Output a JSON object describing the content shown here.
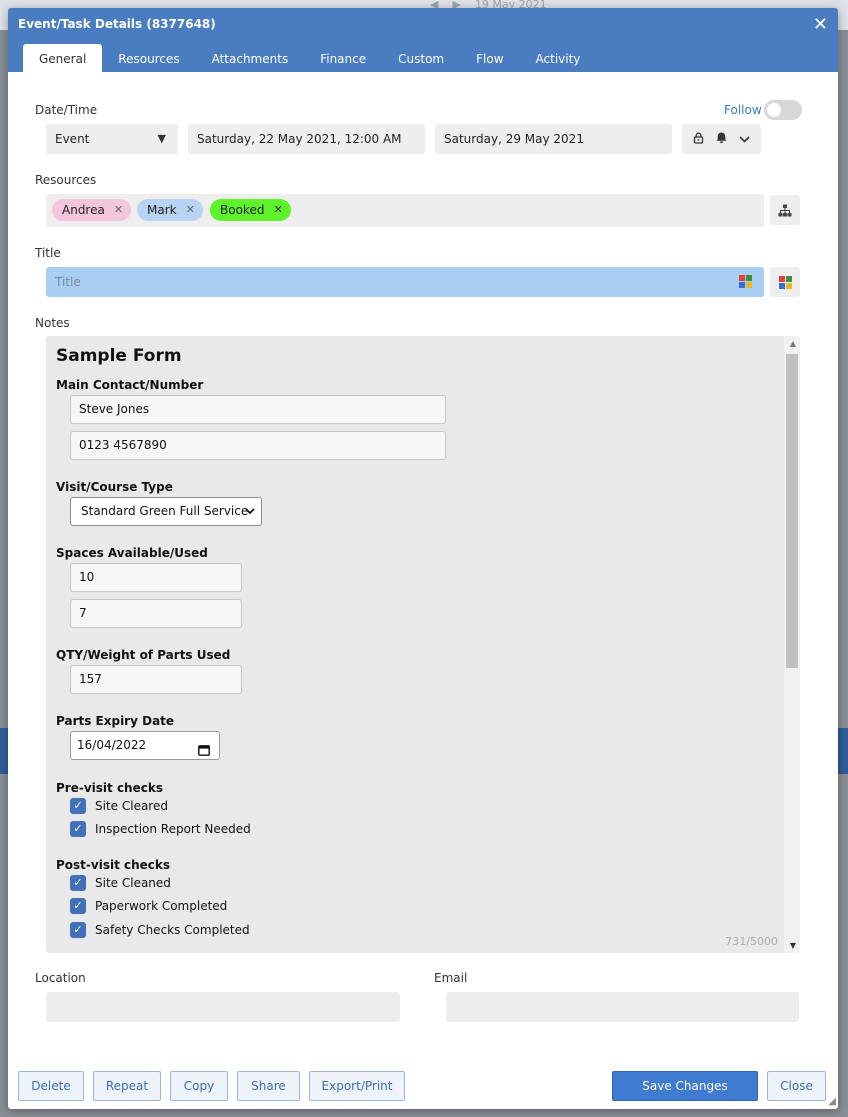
{
  "background": {
    "nav_date": "19 May 2021"
  },
  "dialog": {
    "title": "Event/Task Details (8377648)",
    "close_glyph": "✕"
  },
  "tabs": [
    {
      "label": "General",
      "active": true
    },
    {
      "label": "Resources"
    },
    {
      "label": "Attachments"
    },
    {
      "label": "Finance"
    },
    {
      "label": "Custom"
    },
    {
      "label": "Flow"
    },
    {
      "label": "Activity"
    }
  ],
  "datetime": {
    "label": "Date/Time",
    "follow_label": "Follow",
    "follow_on": false,
    "type_value": "Event",
    "start": "Saturday, 22 May 2021, 12:00 AM",
    "end": "Saturday, 29 May 2021",
    "icons": [
      "lock-icon",
      "alarm-icon",
      "chevron-down-icon"
    ]
  },
  "resources": {
    "label": "Resources",
    "chips": [
      {
        "label": "Andrea",
        "color": "#f4c6dc"
      },
      {
        "label": "Mark",
        "color": "#b9d3f2"
      },
      {
        "label": "Booked",
        "color": "#5ef22b"
      }
    ],
    "hierarchy_icon": "hierarchy-icon"
  },
  "title": {
    "label": "Title",
    "placeholder": "Title",
    "value": ""
  },
  "notes": {
    "label": "Notes",
    "counter": "731/5000",
    "form": {
      "heading": "Sample Form",
      "main_contact": {
        "label": "Main Contact/Number",
        "name": "Steve Jones",
        "number": "0123 4567890"
      },
      "visit_type": {
        "label": "Visit/Course Type",
        "selected": "Standard Green Full Service"
      },
      "spaces": {
        "label": "Spaces Available/Used",
        "available": "10",
        "used": "7"
      },
      "qty": {
        "label": "QTY/Weight of Parts Used",
        "value": "157"
      },
      "expiry": {
        "label": "Parts Expiry Date",
        "value": "16/04/2022"
      },
      "pre_checks": {
        "label": "Pre-visit checks",
        "items": [
          {
            "label": "Site Cleared",
            "checked": true
          },
          {
            "label": "Inspection Report Needed",
            "checked": true
          }
        ]
      },
      "post_checks": {
        "label": "Post-visit checks",
        "items": [
          {
            "label": "Site Cleaned",
            "checked": true
          },
          {
            "label": "Paperwork Completed",
            "checked": true
          },
          {
            "label": "Safety Checks Completed",
            "checked": true
          }
        ]
      }
    }
  },
  "location": {
    "label": "Location",
    "value": ""
  },
  "email": {
    "label": "Email",
    "value": ""
  },
  "footer": {
    "delete": "Delete",
    "repeat": "Repeat",
    "copy": "Copy",
    "share": "Share",
    "export": "Export/Print",
    "save": "Save Changes",
    "close": "Close"
  },
  "colors": {
    "header": "#4a7cc0",
    "title_bg": "#aacdf3",
    "checkbox": "#3f72b8",
    "save_button": "#3f7bd0"
  }
}
